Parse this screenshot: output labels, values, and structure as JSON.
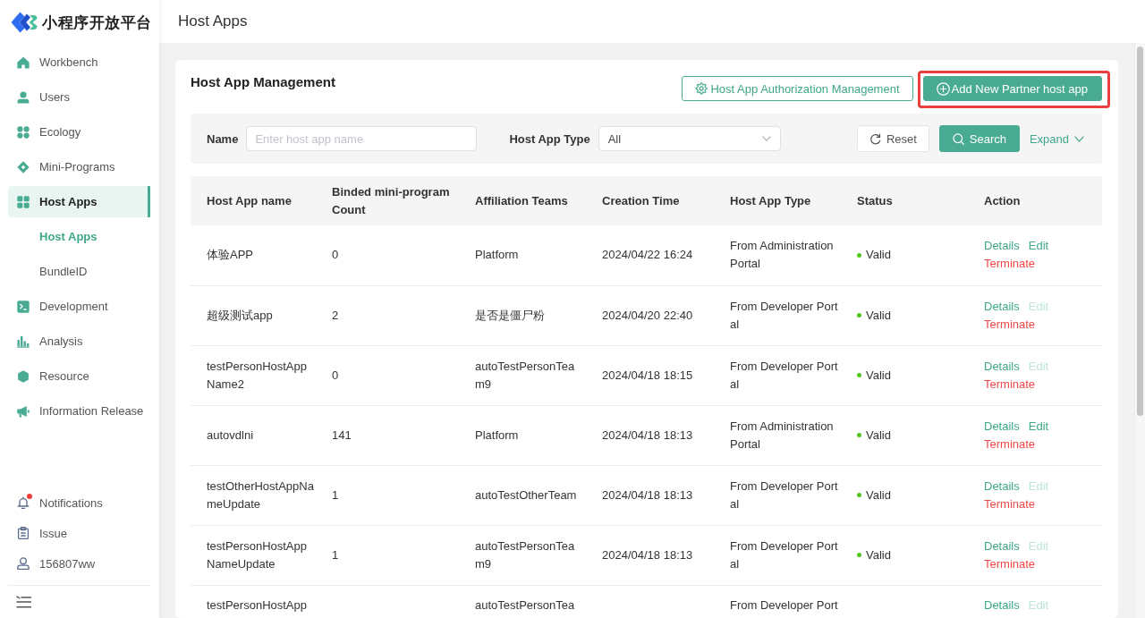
{
  "sidebar": {
    "brand": "小程序开放平台",
    "nav": [
      {
        "label": "Workbench",
        "selected": false
      },
      {
        "label": "Users",
        "selected": false
      },
      {
        "label": "Ecology",
        "selected": false
      },
      {
        "label": "Mini-Programs",
        "selected": false
      },
      {
        "label": "Host Apps",
        "selected": true,
        "children": [
          {
            "label": "Host Apps",
            "selected": true
          },
          {
            "label": "BundleID",
            "selected": false
          }
        ]
      },
      {
        "label": "Development",
        "selected": false
      },
      {
        "label": "Analysis",
        "selected": false
      },
      {
        "label": "Resource",
        "selected": false
      },
      {
        "label": "Information Release",
        "selected": false
      }
    ],
    "footer": [
      {
        "label": "Notifications",
        "unread": true
      },
      {
        "label": "Issue",
        "unread": false
      },
      {
        "label": "156807ww",
        "unread": false
      }
    ]
  },
  "header": {
    "title": "Host Apps"
  },
  "card": {
    "title": "Host App Management",
    "actions": [
      {
        "label": "Host App Authorization Management",
        "kind": "outline",
        "highlighted": false
      },
      {
        "label": "Add New Partner host app",
        "kind": "primary",
        "highlighted": true
      }
    ],
    "filters": {
      "fields": [
        {
          "label": "Name",
          "kind": "input",
          "placeholder": "Enter host app name"
        },
        {
          "label": "Host App Type",
          "kind": "select",
          "value": "All"
        }
      ],
      "buttons": [
        {
          "label": "Reset",
          "kind": "default"
        },
        {
          "label": "Search",
          "kind": "primary"
        }
      ],
      "expand": {
        "label": "Expand",
        "expanded": false
      }
    },
    "table": {
      "columns": [
        "Host App name",
        "Binded mini-program Count",
        "Affiliation Teams",
        "Creation Time",
        "Host App Type",
        "Status",
        "Action"
      ],
      "rows": [
        {
          "kind": "full",
          "name": "体验APP",
          "count": "0",
          "team": "Platform",
          "created": "2024/04/22 16:24",
          "type": "From Administration Portal",
          "status": {
            "label": "Valid",
            "color": "#52c41a"
          },
          "actions": [
            {
              "label": "Details",
              "kind": "details",
              "disabled": false
            },
            {
              "label": "Edit",
              "kind": "edit",
              "disabled": false
            },
            {
              "label": "Terminate",
              "kind": "terminate",
              "disabled": false
            }
          ]
        },
        {
          "kind": "full",
          "name": "超级测试app",
          "count": "2",
          "team": "是否是僵尸粉",
          "created": "2024/04/20 22:40",
          "type": "From Developer Portal",
          "status": {
            "label": "Valid",
            "color": "#52c41a"
          },
          "actions": [
            {
              "label": "Details",
              "kind": "details",
              "disabled": false
            },
            {
              "label": "Edit",
              "kind": "edit",
              "disabled": true
            },
            {
              "label": "Terminate",
              "kind": "terminate",
              "disabled": false
            }
          ]
        },
        {
          "kind": "full",
          "name": "testPersonHostAppName2",
          "count": "0",
          "team": "autoTestPersonTeam9",
          "created": "2024/04/18 18:15",
          "type": "From Developer Portal",
          "status": {
            "label": "Valid",
            "color": "#52c41a"
          },
          "actions": [
            {
              "label": "Details",
              "kind": "details",
              "disabled": false
            },
            {
              "label": "Edit",
              "kind": "edit",
              "disabled": true
            },
            {
              "label": "Terminate",
              "kind": "terminate",
              "disabled": false
            }
          ]
        },
        {
          "kind": "full",
          "name": "autovdlni",
          "count": "141",
          "team": "Platform",
          "created": "2024/04/18 18:13",
          "type": "From Administration Portal",
          "status": {
            "label": "Valid",
            "color": "#52c41a"
          },
          "actions": [
            {
              "label": "Details",
              "kind": "details",
              "disabled": false
            },
            {
              "label": "Edit",
              "kind": "edit",
              "disabled": false
            },
            {
              "label": "Terminate",
              "kind": "terminate",
              "disabled": false
            }
          ]
        },
        {
          "kind": "full",
          "name": "testOtherHostAppNameUpdate",
          "count": "1",
          "team": "autoTestOtherTeam",
          "created": "2024/04/18 18:13",
          "type": "From Developer Portal",
          "status": {
            "label": "Valid",
            "color": "#52c41a"
          },
          "actions": [
            {
              "label": "Details",
              "kind": "details",
              "disabled": false
            },
            {
              "label": "Edit",
              "kind": "edit",
              "disabled": true
            },
            {
              "label": "Terminate",
              "kind": "terminate",
              "disabled": false
            }
          ]
        },
        {
          "kind": "full",
          "name": "testPersonHostAppNameUpdate",
          "count": "1",
          "team": "autoTestPersonTeam9",
          "created": "2024/04/18 18:13",
          "type": "From Developer Portal",
          "status": {
            "label": "Valid",
            "color": "#52c41a"
          },
          "actions": [
            {
              "label": "Details",
              "kind": "details",
              "disabled": false
            },
            {
              "label": "Edit",
              "kind": "edit",
              "disabled": true
            },
            {
              "label": "Terminate",
              "kind": "terminate",
              "disabled": false
            }
          ]
        },
        {
          "kind": "partial",
          "name": "testPersonHostApp",
          "team": "autoTestPersonTea",
          "type": "From Developer Port",
          "actions": [
            {
              "label": "Details",
              "kind": "details",
              "disabled": false
            },
            {
              "label": "Edit",
              "kind": "edit",
              "disabled": true
            }
          ]
        }
      ]
    }
  }
}
